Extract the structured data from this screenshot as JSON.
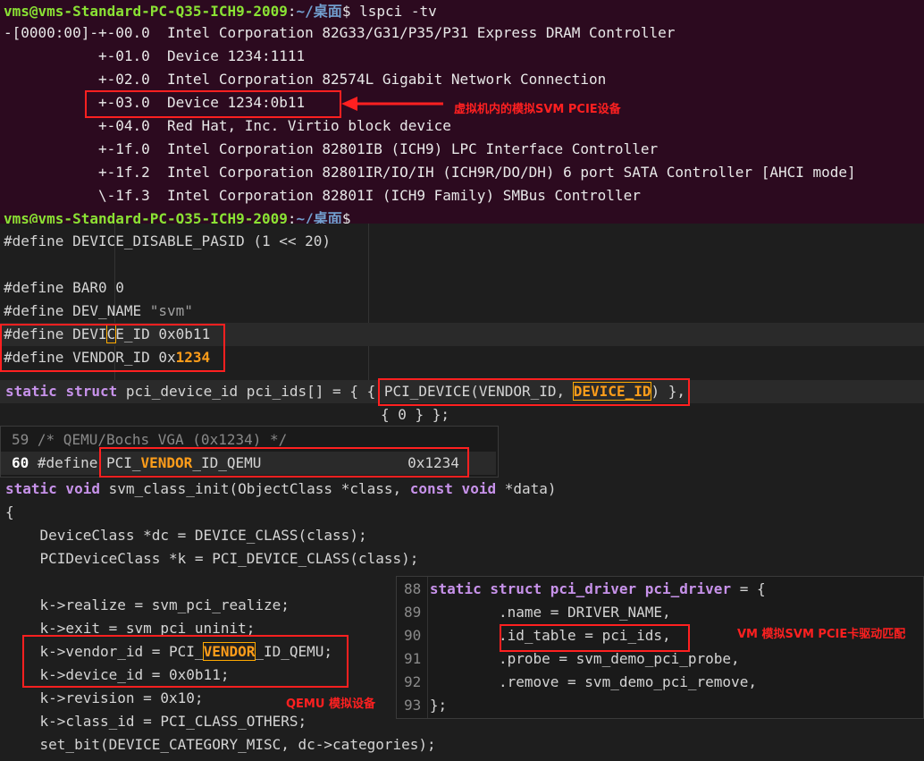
{
  "terminal": {
    "prompt_user": "vms@vms-Standard-PC-Q35-ICH9-2009",
    "prompt_path": "~/桌面",
    "command": "lspci -tv",
    "lines": [
      "-[0000:00]-+-00.0  Intel Corporation 82G33/G31/P35/P31 Express DRAM Controller",
      "           +-01.0  Device 1234:1111",
      "           +-02.0  Intel Corporation 82574L Gigabit Network Connection",
      "           +-03.0  Device 1234:0b11",
      "           +-04.0  Red Hat, Inc. Virtio block device",
      "           +-1f.0  Intel Corporation 82801IB (ICH9) LPC Interface Controller",
      "           +-1f.2  Intel Corporation 82801IR/IO/IH (ICH9R/DO/DH) 6 port SATA Controller [AHCI mode]",
      "           \\-1f.3  Intel Corporation 82801I (ICH9 Family) SMBus Controller"
    ]
  },
  "defines": {
    "line1": "#define DEVICE_DISABLE_PASID (1 << 20)",
    "bar0": "#define BAR0 0",
    "dev_name_prefix": "#define DEV_NAME ",
    "dev_name_value": "\"svm\"",
    "device_id_a": "#define DEVI",
    "device_id_cursor": "C",
    "device_id_b": "E_ID 0x0b11",
    "vendor_id_a": "#define VENDOR_ID 0x",
    "vendor_id_b": "1234"
  },
  "pci_ids": {
    "kw1": "static",
    "kw2": "struct",
    "decl": " pci_device_id pci_ids[] = { ",
    "entry_a": "{ PCI_DEVICE(VENDOR_ID, ",
    "entry_b": "DEVICE_ID",
    "entry_c": ") },",
    "terminator": "{ 0 } };"
  },
  "popup_vendor": {
    "line59_num": "59",
    "line59_text": "/* QEMU/Bochs VGA (0x1234) */",
    "line60_num": "60",
    "line60_define": "#define",
    "line60_a": " PCI_",
    "line60_b": "VENDOR",
    "line60_c": "_ID_QEMU                 0x1234"
  },
  "class_init": {
    "sig_a": "static",
    "sig_b": " void",
    "sig_c": " svm_class_init(ObjectClass *class, ",
    "sig_d": "const",
    "sig_e": " void",
    "sig_f": " *data)",
    "open_brace": "{",
    "l1": "    DeviceClass *dc = DEVICE_CLASS(class);",
    "l2": "    PCIDeviceClass *k = PCI_DEVICE_CLASS(class);",
    "l3": "    k->realize = svm_pci_realize;",
    "l4": "    k->exit = svm_pci_uninit;",
    "l5_a": "    k->vendor_id = PCI_",
    "l5_b": "VENDOR",
    "l5_c": "_ID_QEMU;",
    "l6": "    k->device_id = 0x0b11;",
    "l7": "    k->revision = 0x10;",
    "l8": "    k->class_id = PCI_CLASS_OTHERS;",
    "l9": "    set_bit(DEVICE_CATEGORY_MISC, dc->categories);"
  },
  "popup_driver": {
    "nums": [
      "88",
      "89",
      "90",
      "91",
      "92",
      "93"
    ],
    "l88_a": "static",
    "l88_b": " struct",
    "l88_c": " pci_driver",
    "l88_d": " pci_driver",
    "l88_e": " = {",
    "l89": "        .name = DRIVER_NAME,",
    "l90": "        .id_table = pci_ids,",
    "l91": "        .probe = svm_demo_pci_probe,",
    "l92": "        .remove = svm_demo_pci_remove,",
    "l93": "};"
  },
  "annotations": {
    "virtual_device": "虚拟机内的模拟SVM PCIE设备",
    "qemu_device": "QEMU 模拟设备",
    "driver_match": "VM 模拟SVM PCIE卡驱动匹配"
  },
  "colors": {
    "terminal_bg": "#2c0a1f",
    "annotation_red": "#ff2020",
    "highlight_orange": "#ff9d1a",
    "keyword_purple": "#c792ea"
  }
}
